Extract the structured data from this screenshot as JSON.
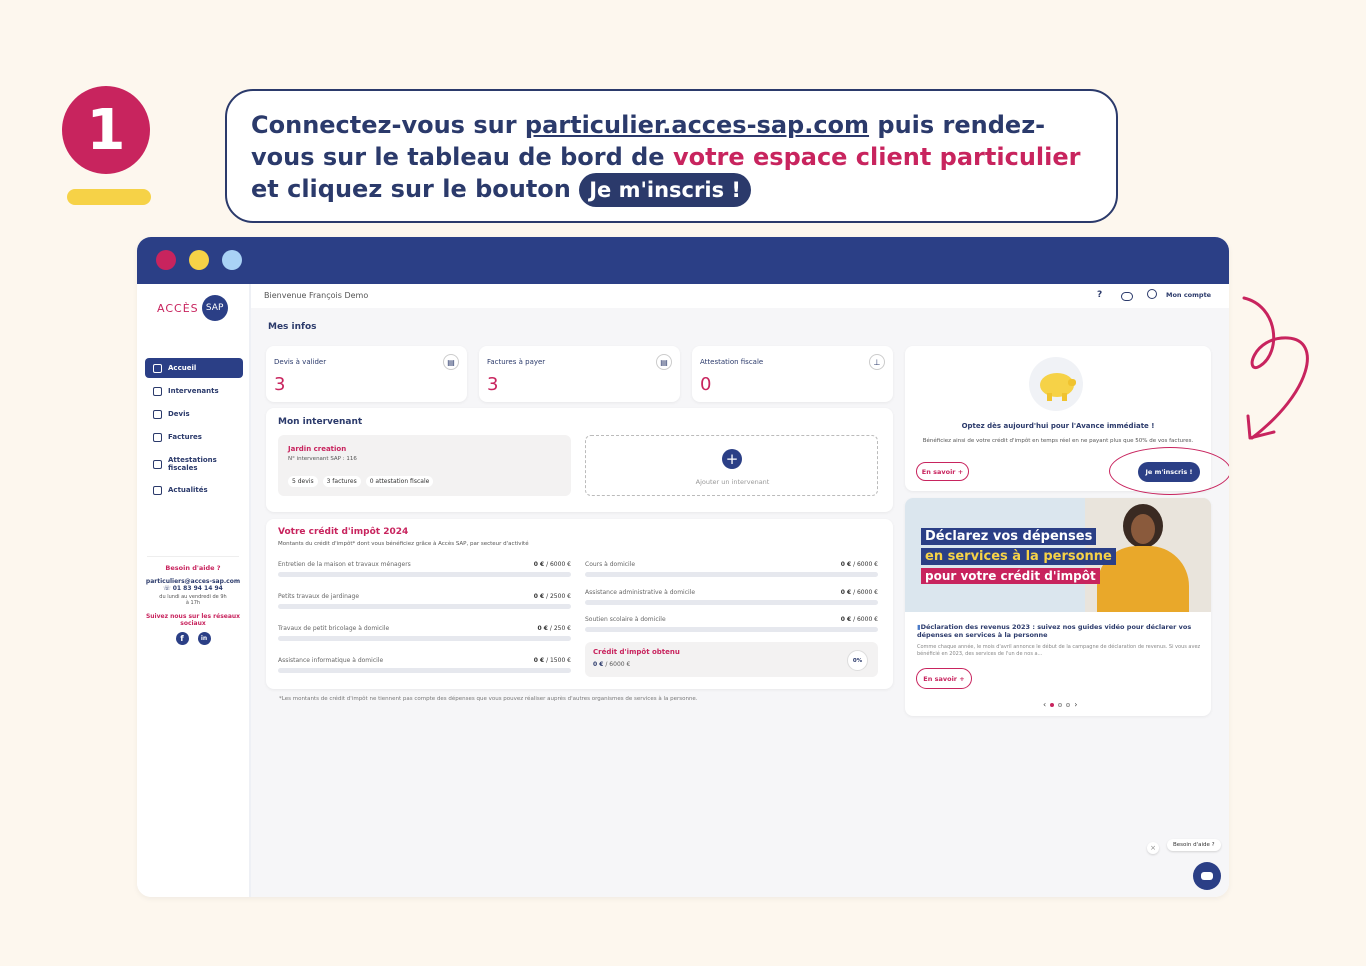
{
  "step": {
    "number": "1"
  },
  "callout": {
    "part1": "Connectez-vous sur ",
    "link": "particulier.acces-sap.com",
    "part2": " puis rendez-vous sur le tableau de bord de ",
    "accent": "votre espace client particulier",
    "part3": " et cliquez sur le bouton ",
    "button": "Je m'inscris !"
  },
  "colors": {
    "brand_navy": "#2b3f86",
    "accent_pink": "#c8245e",
    "yellow": "#f6d247",
    "window_dots": [
      "#c8245e",
      "#f6d247",
      "#a9d2f5"
    ]
  },
  "sidebar": {
    "logo_left": "ACCÈS",
    "logo_right": "SAP",
    "items": [
      {
        "label": "Accueil",
        "icon": "home-icon",
        "active": true
      },
      {
        "label": "Intervenants",
        "icon": "people-icon"
      },
      {
        "label": "Devis",
        "icon": "document-icon"
      },
      {
        "label": "Factures",
        "icon": "invoice-icon"
      },
      {
        "label": "Attestations fiscales",
        "icon": "certificate-icon"
      },
      {
        "label": "Actualités",
        "icon": "news-icon"
      }
    ],
    "help_title": "Besoin d'aide ?",
    "help_email": "particuliers@acces-sap.com",
    "help_phone": "01 83 94 14 94",
    "help_hours": "du lundi au vendredi de 9h à 17h",
    "social_title": "Suivez nous sur les réseaux sociaux",
    "social_icons": [
      "facebook-icon",
      "linkedin-icon"
    ]
  },
  "header": {
    "welcome": "Bienvenue François Demo",
    "account": "Mon compte",
    "icons": [
      "help-icon",
      "chat-icon",
      "user-icon"
    ]
  },
  "main": {
    "section_title": "Mes infos",
    "kpis": [
      {
        "label": "Devis à valider",
        "value": "3",
        "icon": "document-icon"
      },
      {
        "label": "Factures à payer",
        "value": "3",
        "icon": "invoice-icon"
      },
      {
        "label": "Attestation fiscale",
        "value": "0",
        "icon": "stamp-icon"
      }
    ],
    "intervenant": {
      "title": "Mon intervenant",
      "name": "Jardin creation",
      "number": "N° intervenant SAP : 116",
      "tags": [
        "5 devis",
        "3 factures",
        "0 attestation fiscale"
      ],
      "add_label": "Ajouter un intervenant"
    },
    "credit": {
      "title": "Votre crédit d'impôt 2024",
      "subtitle": "Montants du crédit d'impôt* dont vous bénéficiez grâce à Accès SAP, par secteur d'activité",
      "left_rows": [
        {
          "label": "Entretien de la maison et travaux ménagers",
          "value": "0 €",
          "max": "/ 6000 €"
        },
        {
          "label": "Petits travaux de jardinage",
          "value": "0 €",
          "max": "/ 2500 €"
        },
        {
          "label": "Travaux de petit bricolage à domicile",
          "value": "0 €",
          "max": "/ 250 €"
        },
        {
          "label": "Assistance informatique à domicile",
          "value": "0 €",
          "max": "/ 1500 €"
        }
      ],
      "right_rows": [
        {
          "label": "Cours à domicile",
          "value": "0 €",
          "max": "/ 6000 €"
        },
        {
          "label": "Assistance administrative à domicile",
          "value": "0 €",
          "max": "/ 6000 €"
        },
        {
          "label": "Soutien scolaire à domicile",
          "value": "0 €",
          "max": "/ 6000 €"
        }
      ],
      "obtained_title": "Crédit d'impôt obtenu",
      "obtained_value": "0 €",
      "obtained_max": "/ 6000 €",
      "obtained_pct": "0%",
      "footnote": "*Les montants de crédit d'impôt ne tiennent pas compte des dépenses que vous pouvez réaliser auprès d'autres organismes de services à la personne."
    }
  },
  "promo": {
    "title": "Optez dès aujourd'hui pour l'Avance immédiate !",
    "text": "Bénéficiez ainsi de votre crédit d'impôt en temps réel en ne payant plus que 50% de vos factures.",
    "learn_more": "En savoir +",
    "signup": "Je m'inscris !"
  },
  "news": {
    "banner_line1": "Déclarez vos dépenses",
    "banner_line2": "en services à la personne",
    "banner_line3": "pour votre crédit d'impôt",
    "headline": "Déclaration des revenus 2023 : suivez nos guides vidéo pour déclarer vos dépenses en services à la personne",
    "body": "Comme chaque année, le mois d'avril annonce le début de la campagne de déclaration de revenus. Si vous avez bénéficié en 2023, des services de l'un de nos a...",
    "learn_more": "En savoir +"
  },
  "chat": {
    "label": "Besoin d'aide ?"
  }
}
